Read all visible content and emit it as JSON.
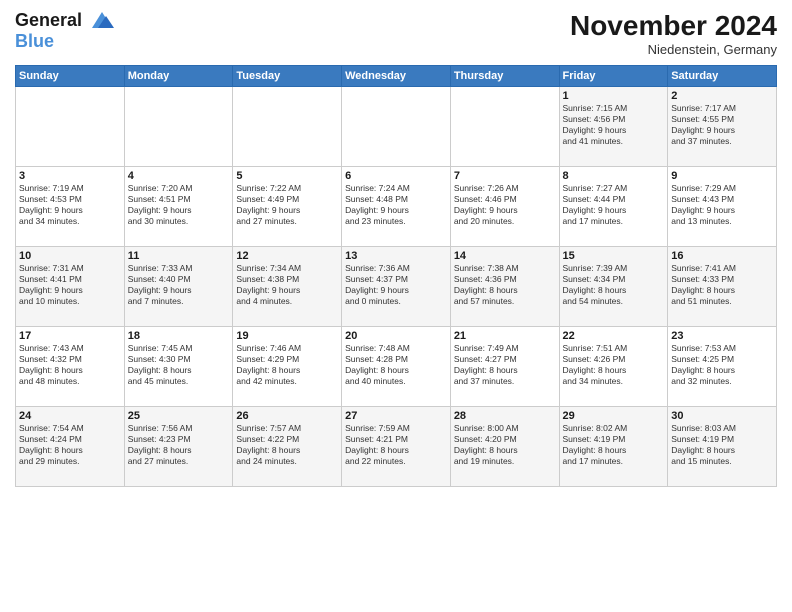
{
  "logo": {
    "line1": "General",
    "line2": "Blue"
  },
  "title": "November 2024",
  "subtitle": "Niedenstein, Germany",
  "days_header": [
    "Sunday",
    "Monday",
    "Tuesday",
    "Wednesday",
    "Thursday",
    "Friday",
    "Saturday"
  ],
  "weeks": [
    [
      {
        "day": "",
        "info": ""
      },
      {
        "day": "",
        "info": ""
      },
      {
        "day": "",
        "info": ""
      },
      {
        "day": "",
        "info": ""
      },
      {
        "day": "",
        "info": ""
      },
      {
        "day": "1",
        "info": "Sunrise: 7:15 AM\nSunset: 4:56 PM\nDaylight: 9 hours\nand 41 minutes."
      },
      {
        "day": "2",
        "info": "Sunrise: 7:17 AM\nSunset: 4:55 PM\nDaylight: 9 hours\nand 37 minutes."
      }
    ],
    [
      {
        "day": "3",
        "info": "Sunrise: 7:19 AM\nSunset: 4:53 PM\nDaylight: 9 hours\nand 34 minutes."
      },
      {
        "day": "4",
        "info": "Sunrise: 7:20 AM\nSunset: 4:51 PM\nDaylight: 9 hours\nand 30 minutes."
      },
      {
        "day": "5",
        "info": "Sunrise: 7:22 AM\nSunset: 4:49 PM\nDaylight: 9 hours\nand 27 minutes."
      },
      {
        "day": "6",
        "info": "Sunrise: 7:24 AM\nSunset: 4:48 PM\nDaylight: 9 hours\nand 23 minutes."
      },
      {
        "day": "7",
        "info": "Sunrise: 7:26 AM\nSunset: 4:46 PM\nDaylight: 9 hours\nand 20 minutes."
      },
      {
        "day": "8",
        "info": "Sunrise: 7:27 AM\nSunset: 4:44 PM\nDaylight: 9 hours\nand 17 minutes."
      },
      {
        "day": "9",
        "info": "Sunrise: 7:29 AM\nSunset: 4:43 PM\nDaylight: 9 hours\nand 13 minutes."
      }
    ],
    [
      {
        "day": "10",
        "info": "Sunrise: 7:31 AM\nSunset: 4:41 PM\nDaylight: 9 hours\nand 10 minutes."
      },
      {
        "day": "11",
        "info": "Sunrise: 7:33 AM\nSunset: 4:40 PM\nDaylight: 9 hours\nand 7 minutes."
      },
      {
        "day": "12",
        "info": "Sunrise: 7:34 AM\nSunset: 4:38 PM\nDaylight: 9 hours\nand 4 minutes."
      },
      {
        "day": "13",
        "info": "Sunrise: 7:36 AM\nSunset: 4:37 PM\nDaylight: 9 hours\nand 0 minutes."
      },
      {
        "day": "14",
        "info": "Sunrise: 7:38 AM\nSunset: 4:36 PM\nDaylight: 8 hours\nand 57 minutes."
      },
      {
        "day": "15",
        "info": "Sunrise: 7:39 AM\nSunset: 4:34 PM\nDaylight: 8 hours\nand 54 minutes."
      },
      {
        "day": "16",
        "info": "Sunrise: 7:41 AM\nSunset: 4:33 PM\nDaylight: 8 hours\nand 51 minutes."
      }
    ],
    [
      {
        "day": "17",
        "info": "Sunrise: 7:43 AM\nSunset: 4:32 PM\nDaylight: 8 hours\nand 48 minutes."
      },
      {
        "day": "18",
        "info": "Sunrise: 7:45 AM\nSunset: 4:30 PM\nDaylight: 8 hours\nand 45 minutes."
      },
      {
        "day": "19",
        "info": "Sunrise: 7:46 AM\nSunset: 4:29 PM\nDaylight: 8 hours\nand 42 minutes."
      },
      {
        "day": "20",
        "info": "Sunrise: 7:48 AM\nSunset: 4:28 PM\nDaylight: 8 hours\nand 40 minutes."
      },
      {
        "day": "21",
        "info": "Sunrise: 7:49 AM\nSunset: 4:27 PM\nDaylight: 8 hours\nand 37 minutes."
      },
      {
        "day": "22",
        "info": "Sunrise: 7:51 AM\nSunset: 4:26 PM\nDaylight: 8 hours\nand 34 minutes."
      },
      {
        "day": "23",
        "info": "Sunrise: 7:53 AM\nSunset: 4:25 PM\nDaylight: 8 hours\nand 32 minutes."
      }
    ],
    [
      {
        "day": "24",
        "info": "Sunrise: 7:54 AM\nSunset: 4:24 PM\nDaylight: 8 hours\nand 29 minutes."
      },
      {
        "day": "25",
        "info": "Sunrise: 7:56 AM\nSunset: 4:23 PM\nDaylight: 8 hours\nand 27 minutes."
      },
      {
        "day": "26",
        "info": "Sunrise: 7:57 AM\nSunset: 4:22 PM\nDaylight: 8 hours\nand 24 minutes."
      },
      {
        "day": "27",
        "info": "Sunrise: 7:59 AM\nSunset: 4:21 PM\nDaylight: 8 hours\nand 22 minutes."
      },
      {
        "day": "28",
        "info": "Sunrise: 8:00 AM\nSunset: 4:20 PM\nDaylight: 8 hours\nand 19 minutes."
      },
      {
        "day": "29",
        "info": "Sunrise: 8:02 AM\nSunset: 4:19 PM\nDaylight: 8 hours\nand 17 minutes."
      },
      {
        "day": "30",
        "info": "Sunrise: 8:03 AM\nSunset: 4:19 PM\nDaylight: 8 hours\nand 15 minutes."
      }
    ]
  ]
}
